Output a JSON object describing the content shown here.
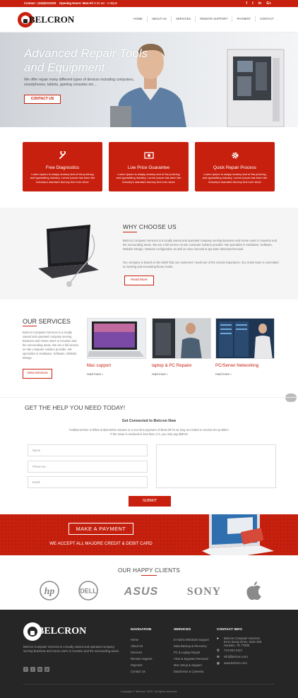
{
  "topbar": {
    "contact_label": "Contact : (416)2312310",
    "hours_label": "Opening Hours: Mon-Fri",
    "hours_value": "8.30 am - 6.30pm",
    "social": [
      "f",
      "t",
      "in",
      "G+"
    ]
  },
  "brand": {
    "name": "BELCRON"
  },
  "nav": {
    "items": [
      "HOME",
      "ABOUT US",
      "SERVICES",
      "REMOTE SUPPORT",
      "PAYMENT",
      "CONTACT"
    ]
  },
  "hero": {
    "title": "Advanced Repair Tools and Equipment",
    "subtitle": "We offer repair many different types of devices including computers, smartphones, tablets, gaming consoles etc...",
    "button": "CONTACT US"
  },
  "features": [
    {
      "icon": "wrench-icon",
      "title": "Free Diagnostics",
      "text": "Lorem Ipsum is simply dummy text of the print-ing and typesetting industry. Lorem Ipsum has been the industry's standard dummy text ever since"
    },
    {
      "icon": "money-icon",
      "title": "Low Price Guarantee",
      "text": "Lorem Ipsum is simply dummy text of the print-ing and typesetting industry. Lorem Ipsum has been the industry's standard dummy text ever since"
    },
    {
      "icon": "gear-icon",
      "title": "Quick Repair Process",
      "text": "Lorem Ipsum is simply dummy text of the print-ing and typesetting industry. Lorem Ipsum has been the industry's standard dummy text ever since"
    }
  ],
  "why": {
    "title": "WHY CHOOSE US",
    "p1": "Belcron Computer Services is a locally owned and operated company serving Business and Home users in Houston and the surrounding areas. We are a full service on-site computer solution provider. We specialize in Hardware, Software, Website Design, Network configuration as well as virus removal & spy-ware detection/removal.",
    "p2": "Our company is based on the belief that our customers' needs are of the utmost importance. Our entire team is committed to meeting and exceeding those needs.",
    "button": "Read More"
  },
  "services": {
    "title": "OUR SERVICES",
    "desc": "Belcron Computer Services is a locally owned and operated company serving Business and Home users in Houston and the surrounding areas. We are a full service on-site computer solution provider. We specialize in Hardware, Software, Website Design.",
    "button": "View services",
    "cards": [
      {
        "title": "Mac support",
        "more": "read more"
      },
      {
        "title": "laptop & PC Repaire",
        "more": "read more"
      },
      {
        "title": "PC/Server Networking",
        "more": "read more"
      }
    ]
  },
  "help": {
    "title": "GET THE HELP YOU NEED TODAY!",
    "subtitle": "Get Connected to Belcron Now",
    "note1": "*Additional time is billed at $25.00/15 minutes or a one time payment of $125.00 for as long as it takes to resolve the problem.",
    "note2": "If the Issue is resolved in less than 1 hr, you only pay $89.00",
    "name_placeholder": "Name",
    "phone_placeholder": "Phone No.",
    "email_placeholder": "Email",
    "submit": "SUBMIT"
  },
  "payment": {
    "button": "MAKE A PAYMENT",
    "text": "WE ACCEPT ALL MAJORE CREDIT & DEBIT CARD"
  },
  "clients": {
    "title": "OUR HAPPY CLIENTS",
    "logos": [
      "hp",
      "DELL",
      "ASUS",
      "SONY",
      "Apple"
    ]
  },
  "footer": {
    "desc": "Belcron Computer Services is a locally owned and operated company serving Business and Home users in Houston and the surrounding areas.",
    "social": [
      "f",
      "t",
      "in",
      "yt"
    ],
    "nav_title": "NAVIGATION",
    "nav_items": [
      "Home",
      "About Us",
      "Services",
      "Remote Support",
      "Payment",
      "Contact Us"
    ],
    "services_title": "SERVICES",
    "services_items": [
      "E-mail & Windows Support",
      "Data Backup & Recovery",
      "PC & Laptop Repair",
      "Virus & Spyware Removal",
      "Mac Setup & Support",
      "Data/Voice & Cameras"
    ],
    "contact_title": "CONTACT INFO",
    "address_line1": "Belcron Computer Services",
    "address_line2": "6141 Savoy Drive, Suite 338",
    "address_line3": "Houston, TX 77036",
    "phone": "713-931-2112",
    "email": "info@belcron.com",
    "website": "www.belcron.com",
    "copyright": "Copyright © Belcron 2016. All rights reserved."
  },
  "colors": {
    "accent": "#c8200e",
    "footer_bg": "#262626"
  }
}
